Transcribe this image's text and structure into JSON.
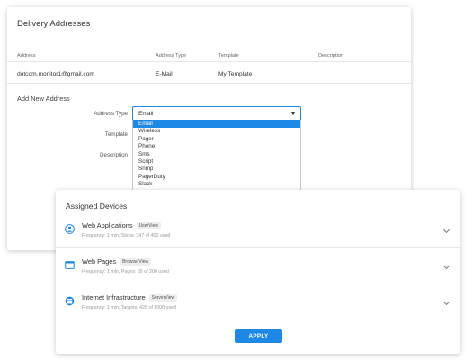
{
  "delivery": {
    "title": "Delivery Addresses",
    "columns": [
      "Address",
      "Address Type",
      "Template",
      "Description"
    ],
    "rows": [
      {
        "address": "dotcom.monitor1@gmail.com",
        "type": "E-Mail",
        "template": "My Template",
        "description": ""
      }
    ],
    "add_section": "Add New Address",
    "fields": {
      "address_type_label": "Address Type",
      "template_label": "Template",
      "description_label": "Description"
    },
    "address_type_value": "Email",
    "dropdown_options": [
      "Email",
      "Wireless",
      "Pager",
      "Phone",
      "Sms",
      "Script",
      "Snmp",
      "PagerDuty",
      "Slack"
    ],
    "selected_option": "Email"
  },
  "assigned": {
    "title": "Assigned Devices",
    "items": [
      {
        "name": "Web Applications",
        "badge": "UserView",
        "meta": "Frequency: 1 min, Steps: 347 of 400 used",
        "icon": "user-view-icon"
      },
      {
        "name": "Web Pages",
        "badge": "BrowserView",
        "meta": "Frequency: 1 min, Pages: 55 of 200 used",
        "icon": "browser-view-icon"
      },
      {
        "name": "Internet Infrastructure",
        "badge": "ServerView",
        "meta": "Frequency: 1 min, Targets: 428 of 1000 used",
        "icon": "server-view-icon"
      }
    ],
    "apply_label": "APPLY"
  },
  "colors": {
    "accent": "#1e88e5",
    "icon": "#1e88e5"
  }
}
